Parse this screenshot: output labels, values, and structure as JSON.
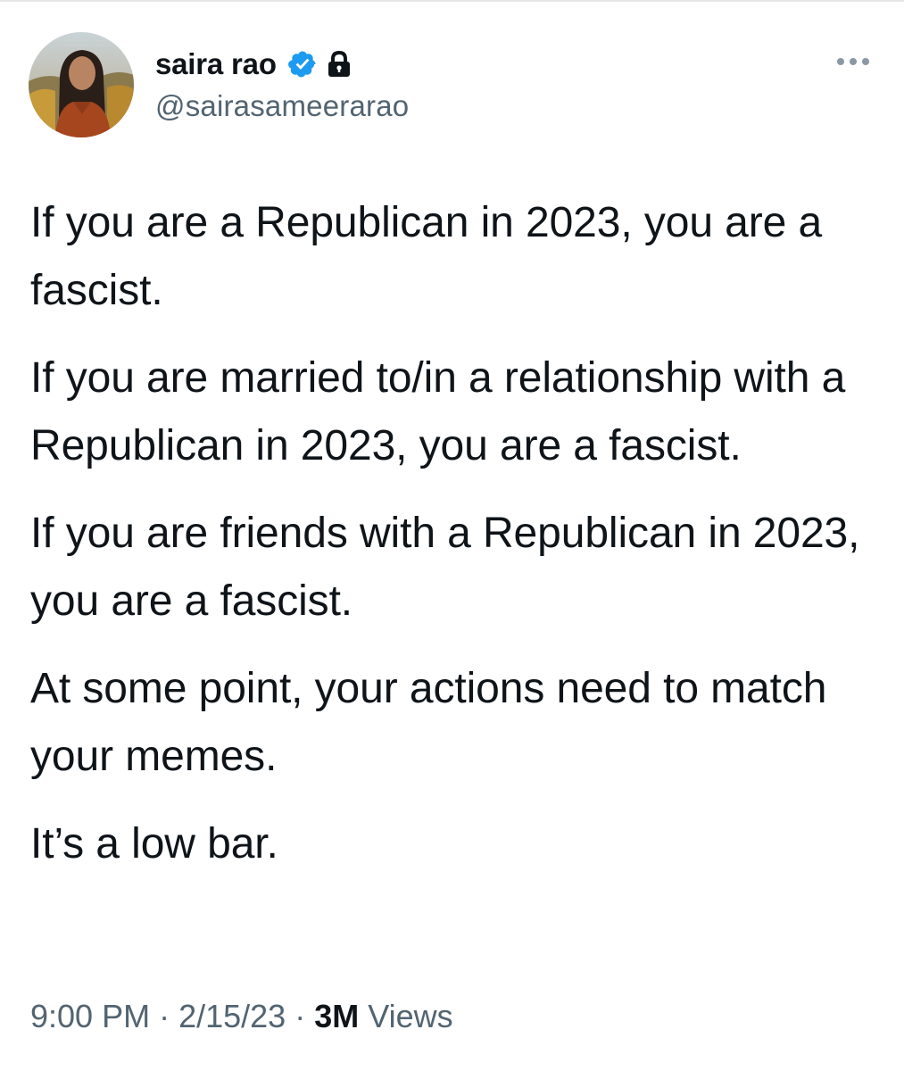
{
  "author": {
    "display_name": "saira rao",
    "handle": "@sairasameerarao",
    "verified_icon": "verified-badge-icon",
    "protected_icon": "lock-icon",
    "verified_color": "#1d9bf0"
  },
  "menu": {
    "icon": "more-horizontal-icon"
  },
  "tweet": {
    "paragraphs": [
      "If you are a Republican in 2023, you are a fascist.",
      "If you are married to/in a relationship with a Republican in 2023, you are a fascist.",
      "If you are friends with a Republican in 2023, you are a fascist.",
      "At some point, your actions need to match your memes.",
      "It’s a low bar."
    ]
  },
  "meta": {
    "time": "9:00 PM",
    "separator": "·",
    "date": "2/15/23",
    "views_count": "3M",
    "views_label": "Views"
  },
  "colors": {
    "text": "#0f1419",
    "secondary": "#536471"
  }
}
